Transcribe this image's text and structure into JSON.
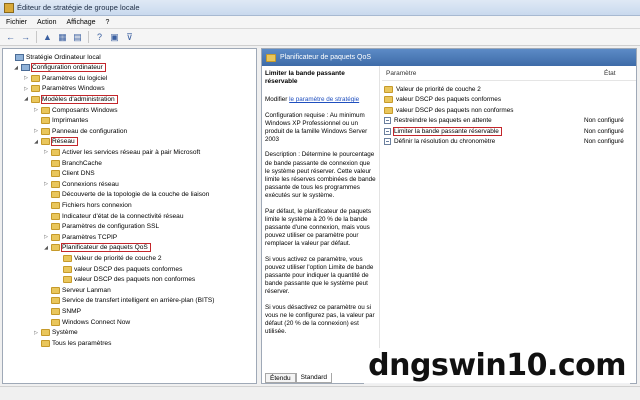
{
  "window": {
    "title": "Éditeur de stratégie de groupe locale"
  },
  "menu": [
    "Fichier",
    "Action",
    "Affichage",
    "?"
  ],
  "toolbar": [
    {
      "name": "back-icon",
      "glyph": "←"
    },
    {
      "name": "forward-icon",
      "glyph": "→"
    },
    {
      "name": "up-icon",
      "glyph": "▲"
    },
    {
      "name": "show-hide-tree-icon",
      "glyph": "▦"
    },
    {
      "name": "export-list-icon",
      "glyph": "▤"
    },
    {
      "name": "help-icon",
      "glyph": "?"
    },
    {
      "name": "properties-icon",
      "glyph": "▣"
    },
    {
      "name": "filter-icon",
      "glyph": "⊽"
    }
  ],
  "tree": [
    {
      "label": "Stratégie Ordinateur local",
      "icon": "computer",
      "expander": "",
      "highlighted": false
    },
    {
      "label": "Configuration ordinateur",
      "icon": "computer",
      "expander": "◢",
      "highlighted": true
    },
    {
      "label": "Paramètres du logiciel",
      "icon": "folder",
      "expander": "▷",
      "highlighted": false
    },
    {
      "label": "Paramètres Windows",
      "icon": "folder",
      "expander": "▷",
      "highlighted": false
    },
    {
      "label": "Modèles d'administration",
      "icon": "folder",
      "expander": "◢",
      "highlighted": true
    },
    {
      "label": "Composants Windows",
      "icon": "folder",
      "expander": "▷",
      "highlighted": false
    },
    {
      "label": "Imprimantes",
      "icon": "folder",
      "expander": "",
      "highlighted": false
    },
    {
      "label": "Panneau de configuration",
      "icon": "folder",
      "expander": "▷",
      "highlighted": false
    },
    {
      "label": "Réseau",
      "icon": "folder",
      "expander": "◢",
      "highlighted": true
    },
    {
      "label": "Activer les services réseau pair à pair Microsoft",
      "icon": "folder",
      "expander": "▷",
      "highlighted": false
    },
    {
      "label": "BranchCache",
      "icon": "folder",
      "expander": "",
      "highlighted": false
    },
    {
      "label": "Client DNS",
      "icon": "folder",
      "expander": "",
      "highlighted": false
    },
    {
      "label": "Connexions réseau",
      "icon": "folder",
      "expander": "▷",
      "highlighted": false
    },
    {
      "label": "Découverte de la topologie de la couche de liaison",
      "icon": "folder",
      "expander": "",
      "highlighted": false
    },
    {
      "label": "Fichiers hors connexion",
      "icon": "folder",
      "expander": "",
      "highlighted": false
    },
    {
      "label": "Indicateur d'état de la connectivité réseau",
      "icon": "folder",
      "expander": "",
      "highlighted": false
    },
    {
      "label": "Paramètres de configuration SSL",
      "icon": "folder",
      "expander": "",
      "highlighted": false
    },
    {
      "label": "Paramètres TCPIP",
      "icon": "folder",
      "expander": "▷",
      "highlighted": false
    },
    {
      "label": "Planificateur de paquets QoS",
      "icon": "folder",
      "expander": "◢",
      "highlighted": true
    },
    {
      "label": "Valeur de priorité de couche 2",
      "icon": "folder",
      "expander": "",
      "highlighted": false
    },
    {
      "label": "valeur DSCP des paquets conformes",
      "icon": "folder",
      "expander": "",
      "highlighted": false
    },
    {
      "label": "valeur DSCP des paquets non conformes",
      "icon": "folder",
      "expander": "",
      "highlighted": false
    },
    {
      "label": "Serveur Lanman",
      "icon": "folder",
      "expander": "",
      "highlighted": false
    },
    {
      "label": "Service de transfert intelligent en arrière-plan (BITS)",
      "icon": "folder",
      "expander": "",
      "highlighted": false
    },
    {
      "label": "SNMP",
      "icon": "folder",
      "expander": "",
      "highlighted": false
    },
    {
      "label": "Windows Connect Now",
      "icon": "folder",
      "expander": "",
      "highlighted": false
    },
    {
      "label": "Système",
      "icon": "folder",
      "expander": "▷",
      "highlighted": false
    },
    {
      "label": "Tous les paramètres",
      "icon": "folder",
      "expander": "",
      "highlighted": false
    }
  ],
  "right": {
    "header": "Planificateur de paquets QoS",
    "description": {
      "title": "Limiter la bande passante réservable",
      "edit_prefix": "Modifier",
      "edit_link": "le paramètre de stratégie",
      "paragraphs": [
        "Configuration requise : Au minimum Windows XP Professionnel ou un produit de la famille Windows Server 2003",
        "Description : Détermine le pourcentage de bande passante de connexion que le système peut réserver. Cette valeur limite les réserves combinées de bande passante de tous les programmes exécutés sur le système.",
        "Par défaut, le planificateur de paquets limite le système à 20 % de la bande passante d'une connexion, mais vous pouvez utiliser ce paramètre pour remplacer la valeur par défaut.",
        "Si vous activez ce paramètre, vous pouvez utiliser l'option Limite de bande passante pour indiquer la quantité de bande passante que le système peut réserver.",
        "Si vous désactivez ce paramètre ou si vous ne le configurez pas, la valeur par défaut (20 % de la connexion) est utilisée."
      ]
    },
    "columns": {
      "name": "Paramètre",
      "state": "État"
    },
    "rows": [
      {
        "label": "Valeur de priorité de couche 2",
        "state": "",
        "icon": "folder",
        "highlighted": false
      },
      {
        "label": "valeur DSCP des paquets conformes",
        "state": "",
        "icon": "folder",
        "highlighted": false
      },
      {
        "label": "valeur DSCP des paquets non conformes",
        "state": "",
        "icon": "folder",
        "highlighted": false
      },
      {
        "label": "Restreindre les paquets en attente",
        "state": "Non configuré",
        "icon": "setting",
        "highlighted": false
      },
      {
        "label": "Limiter la bande passante réservable",
        "state": "Non configuré",
        "icon": "setting",
        "highlighted": true
      },
      {
        "label": "Définir la résolution du chronomètre",
        "state": "Non configuré",
        "icon": "setting",
        "highlighted": false
      }
    ],
    "tabs": [
      "Étendu",
      "Standard"
    ]
  },
  "watermark": "dngswin10.com"
}
